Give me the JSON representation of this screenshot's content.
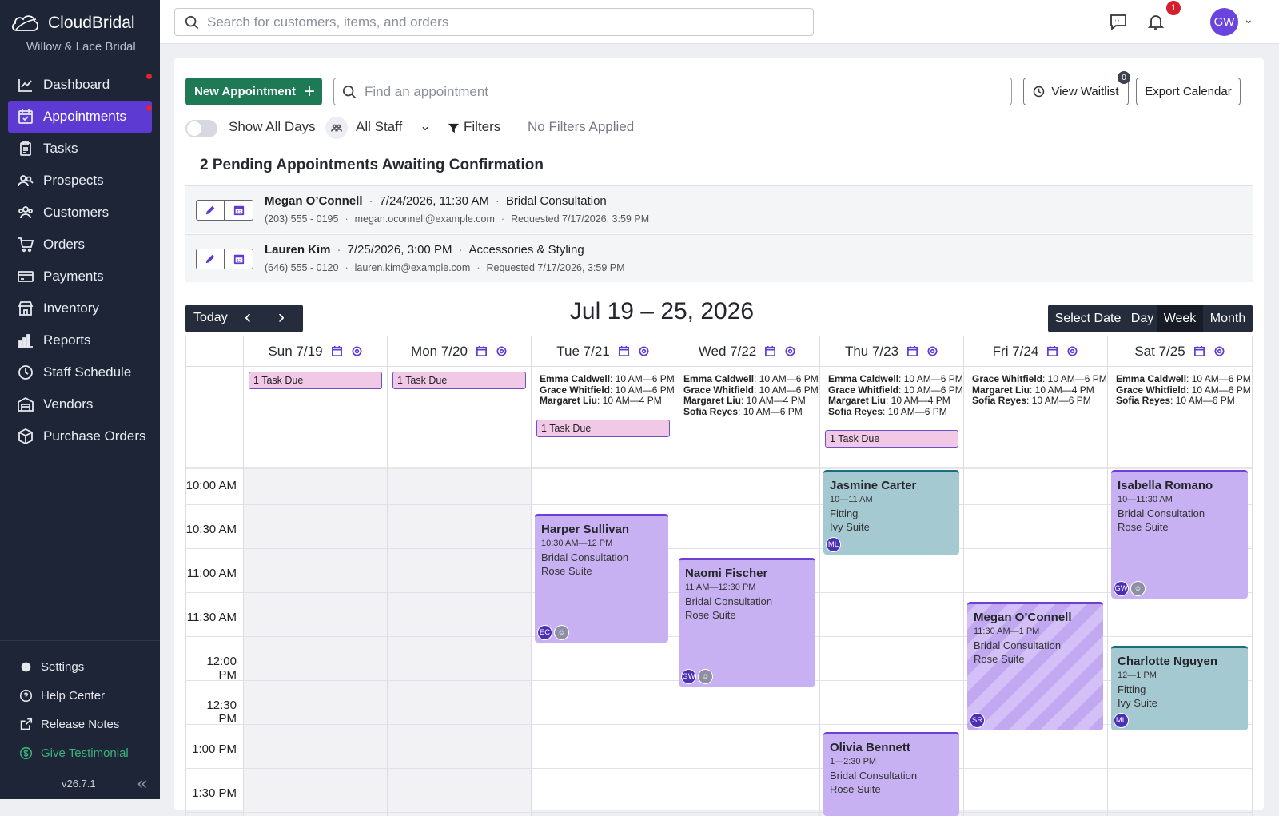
{
  "app": {
    "name": "CloudBridal",
    "store": "Willow & Lace Bridal",
    "version": "v26.7.1"
  },
  "sidebar": {
    "items": [
      {
        "label": "Dashboard",
        "icon": "chart-line-icon",
        "dot": true
      },
      {
        "label": "Appointments",
        "icon": "calendar-check-icon",
        "active": true,
        "dot": true
      },
      {
        "label": "Tasks",
        "icon": "clipboard-icon"
      },
      {
        "label": "Prospects",
        "icon": "users-search-icon"
      },
      {
        "label": "Customers",
        "icon": "users-icon"
      },
      {
        "label": "Orders",
        "icon": "cart-icon"
      },
      {
        "label": "Payments",
        "icon": "credit-card-icon"
      },
      {
        "label": "Inventory",
        "icon": "store-icon"
      },
      {
        "label": "Reports",
        "icon": "bar-chart-icon"
      },
      {
        "label": "Staff Schedule",
        "icon": "clock-icon"
      },
      {
        "label": "Vendors",
        "icon": "warehouse-icon"
      },
      {
        "label": "Purchase Orders",
        "icon": "box-icon"
      }
    ],
    "bottom": {
      "settings": "Settings",
      "help": "Help Center",
      "release": "Release Notes",
      "testimonial": "Give Testimonial"
    }
  },
  "topbar": {
    "search_placeholder": "Search for customers, items, and orders",
    "notif_count": "1",
    "user_initials": "GW"
  },
  "toolbar": {
    "new_appt": "New Appointment",
    "appt_search_placeholder": "Find an appointment",
    "view_waitlist": "View Waitlist",
    "waitlist_count": "0",
    "export_calendar": "Export Calendar",
    "show_all_days": "Show All Days",
    "all_staff": "All Staff",
    "filters": "Filters",
    "filter_status": "No Filters Applied"
  },
  "pending": {
    "title": "2 Pending Appointments Awaiting Confirmation",
    "rows": [
      {
        "name": "Megan O’Connell",
        "datetime": "7/24/2026, 11:30 AM",
        "service": "Bridal Consultation",
        "phone": "(203) 555 - 0195",
        "email": "megan.oconnell@example.com",
        "requested": "Requested 7/17/2026, 3:59 PM"
      },
      {
        "name": "Lauren Kim",
        "datetime": "7/25/2026, 3:00 PM",
        "service": "Accessories & Styling",
        "phone": "(646) 555 - 0120",
        "email": "lauren.kim@example.com",
        "requested": "Requested 7/17/2026, 3:59 PM"
      }
    ]
  },
  "calendar": {
    "today": "Today",
    "title": "Jul 19 – 25, 2026",
    "views": [
      "Select Date",
      "Day",
      "Week",
      "Month"
    ],
    "active_view": "Week",
    "days": [
      {
        "label": "Sun 7/19",
        "closed": true,
        "staff": [],
        "tasks": "1 Task Due"
      },
      {
        "label": "Mon 7/20",
        "closed": true,
        "staff": [],
        "tasks": "1 Task Due"
      },
      {
        "label": "Tue 7/21",
        "staff": [
          {
            "name": "Emma Caldwell",
            "hours": ": 10 AM—6 PM"
          },
          {
            "name": "Grace Whitfield",
            "hours": ": 10 AM—6 PM"
          },
          {
            "name": "Margaret Liu",
            "hours": ": 10 AM—4 PM"
          }
        ],
        "tasks": "1 Task Due"
      },
      {
        "label": "Wed 7/22",
        "staff": [
          {
            "name": "Emma Caldwell",
            "hours": ": 10 AM—6 PM"
          },
          {
            "name": "Grace Whitfield",
            "hours": ": 10 AM—6 PM"
          },
          {
            "name": "Margaret Liu",
            "hours": ": 10 AM—4 PM"
          },
          {
            "name": "Sofia Reyes",
            "hours": ": 10 AM—6 PM"
          }
        ]
      },
      {
        "label": "Thu 7/23",
        "staff": [
          {
            "name": "Emma Caldwell",
            "hours": ": 10 AM—6 PM"
          },
          {
            "name": "Grace Whitfield",
            "hours": ": 10 AM—6 PM"
          },
          {
            "name": "Margaret Liu",
            "hours": ": 10 AM—4 PM"
          },
          {
            "name": "Sofia Reyes",
            "hours": ": 10 AM—6 PM"
          }
        ],
        "tasks": "1 Task Due"
      },
      {
        "label": "Fri 7/24",
        "staff": [
          {
            "name": "Grace Whitfield",
            "hours": ": 10 AM—6 PM"
          },
          {
            "name": "Margaret Liu",
            "hours": ": 10 AM—4 PM"
          },
          {
            "name": "Sofia Reyes",
            "hours": ": 10 AM—6 PM"
          }
        ]
      },
      {
        "label": "Sat 7/25",
        "staff": [
          {
            "name": "Emma Caldwell",
            "hours": ": 10 AM—6 PM"
          },
          {
            "name": "Grace Whitfield",
            "hours": ": 10 AM—6 PM"
          },
          {
            "name": "Sofia Reyes",
            "hours": ": 10 AM—6 PM"
          }
        ]
      }
    ],
    "times": [
      "10:00 AM",
      "10:30 AM",
      "11:00 AM",
      "11:30 AM",
      "12:00 PM",
      "12:30 PM",
      "1:00 PM",
      "1:30 PM"
    ],
    "appointments": [
      {
        "name": "Harper Sullivan",
        "time": "10:30 AM—12 PM",
        "service": "Bridal Consultation",
        "room": "Rose Suite",
        "staff": "EC",
        "ghost": true
      },
      {
        "name": "Naomi Fischer",
        "time": "11 AM—12:30 PM",
        "service": "Bridal Consultation",
        "room": "Rose Suite",
        "staff": "GW",
        "ghost": true
      },
      {
        "name": "Jasmine Carter",
        "time": "10—11 AM",
        "service": "Fitting",
        "room": "Ivy Suite",
        "staff": "ML"
      },
      {
        "name": "Olivia Bennett",
        "time": "1—2:30 PM",
        "service": "Bridal Consultation",
        "room": "Rose Suite"
      },
      {
        "name": "Megan O’Connell",
        "time": "11:30 AM—1 PM",
        "service": "Bridal Consultation",
        "room": "Rose Suite",
        "staff": "SR",
        "pending": true
      },
      {
        "name": "Isabella Romano",
        "time": "10—11:30 AM",
        "service": "Bridal Consultation",
        "room": "Rose Suite",
        "staff": "GW",
        "ghost": true
      },
      {
        "name": "Charlotte Nguyen",
        "time": "12—1 PM",
        "service": "Fitting",
        "room": "Ivy Suite",
        "staff": "ML"
      }
    ]
  }
}
